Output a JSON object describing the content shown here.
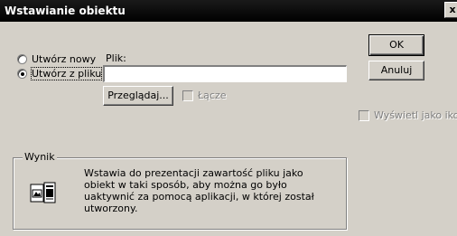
{
  "dialog": {
    "title": "Wstawianie obiektu",
    "close_glyph": "x"
  },
  "options": {
    "create_new": "Utwórz nowy",
    "create_from_file": "Utwórz z pliku",
    "selected": "create_from_file"
  },
  "file": {
    "label": "Plik:",
    "value": ""
  },
  "buttons": {
    "ok": "OK",
    "cancel": "Anuluj",
    "browse": "Przeglądaj..."
  },
  "link_checkbox": {
    "label": "Łącze",
    "checked": false,
    "enabled": false
  },
  "display_icon_checkbox": {
    "label": "Wyświetl jako ikonę",
    "checked": false,
    "enabled": false
  },
  "result": {
    "group_label": "Wynik",
    "text": "Wstawia do prezentacji zawartość pliku jako obiekt w taki sposób, aby można go było uaktywnić za pomocą aplikacji, w której został utworzony.",
    "icon": "file-object-icon"
  }
}
